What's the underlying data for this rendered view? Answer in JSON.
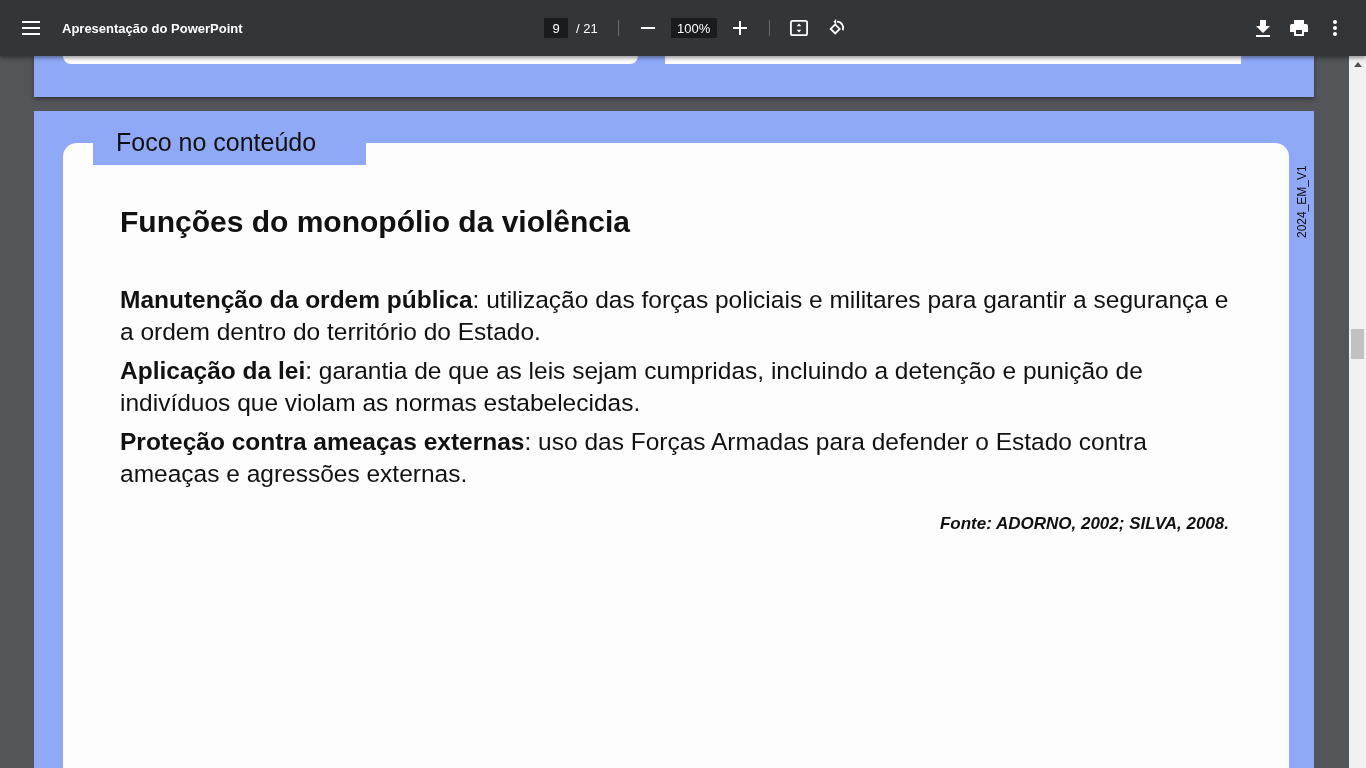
{
  "toolbar": {
    "title": "Apresentação do PowerPoint",
    "page_input": "9",
    "page_total": "/ 21",
    "zoom": "100%"
  },
  "slide": {
    "tab_label": "Foco no conteúdo",
    "side_code": "2024_EM_V1",
    "title": "Funções do monopólio da violência",
    "paragraphs": [
      "**Manutenção da ordem pública**: utilização das forças policiais e militares para garantir a segurança e a ordem dentro do território do Estado.",
      "**Aplicação da lei**: garantia de que as leis sejam cumpridas, incluindo a detenção e punição de indivíduos que violam as normas estabelecidas.",
      "**Proteção contra ameaças externas**: uso das Forças Armadas para defender o Estado contra ameaças e agressões externas."
    ],
    "source": "Fonte: ADORNO, 2002; SILVA, 2008."
  }
}
